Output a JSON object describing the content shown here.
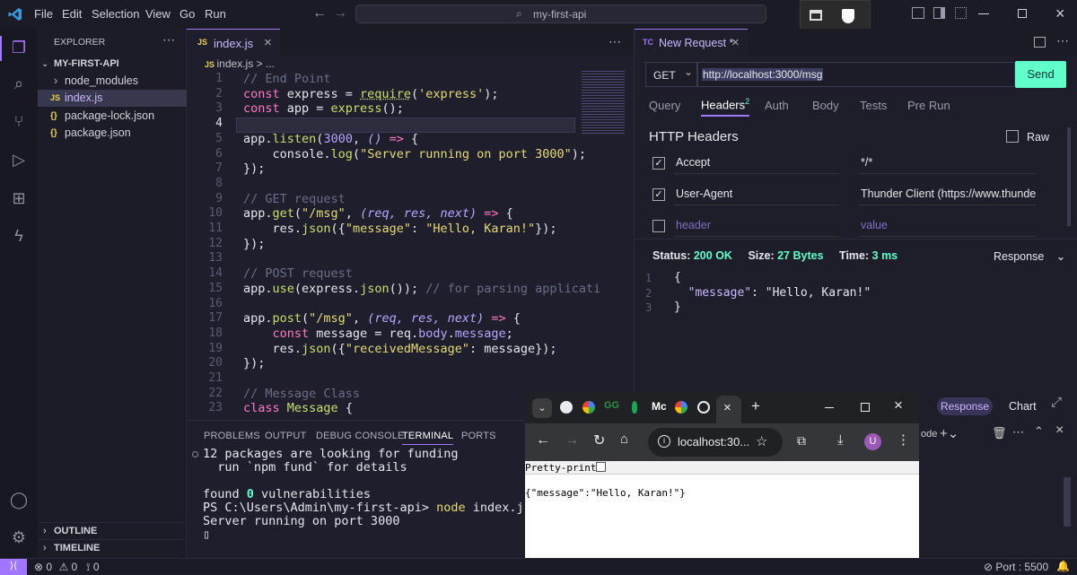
{
  "menu": [
    "File",
    "Edit",
    "Selection",
    "View",
    "Go",
    "Run"
  ],
  "search": {
    "value": "my-first-api"
  },
  "explorer": {
    "title": "EXPLORER",
    "project": "MY-FIRST-API",
    "items": [
      {
        "icon": "›",
        "label": "node_modules",
        "type": "folder"
      },
      {
        "icon": "JS",
        "label": "index.js",
        "type": "js"
      },
      {
        "icon": "{}",
        "label": "package-lock.json",
        "type": "json"
      },
      {
        "icon": "{}",
        "label": "package.json",
        "type": "json"
      }
    ],
    "outline": "OUTLINE",
    "timeline": "TIMELINE"
  },
  "editor": {
    "tab_icon": "JS",
    "tab_label": "index.js",
    "tab_close": "×",
    "breadcrumb": "index.js > ...",
    "line_numbers": [
      "1",
      "2",
      "3",
      "4",
      "5",
      "6",
      "7",
      "8",
      "9",
      "10",
      "11",
      "12",
      "13",
      "14",
      "15",
      "16",
      "17",
      "18",
      "19",
      "20",
      "21",
      "22",
      "23"
    ]
  },
  "panel": {
    "tabs": [
      "PROBLEMS",
      "OUTPUT",
      "DEBUG CONSOLE",
      "TERMINAL",
      "PORTS"
    ],
    "active_tab": "TERMINAL",
    "lines": [
      "12 packages are looking for funding",
      "  run `npm fund` for details",
      "",
      "found 0 vulnerabilities",
      "PS C:\\Users\\Admin\\my-first-api> node index.js",
      "Server running on port 3000"
    ],
    "cursor": "▯"
  },
  "thunder": {
    "tab_icon": "TC",
    "tab_label": "New Request *",
    "method": "GET",
    "url": "http://localhost:3000/msg",
    "send": "Send",
    "tabs": [
      "Query",
      "Headers",
      "Auth",
      "Body",
      "Tests",
      "Pre Run"
    ],
    "headers_badge": "2",
    "section_title": "HTTP Headers",
    "raw": "Raw",
    "headers": [
      {
        "checked": true,
        "key": "Accept",
        "value": "*/*"
      },
      {
        "checked": true,
        "key": "User-Agent",
        "value": "Thunder Client (https://www.thundercl"
      },
      {
        "checked": false,
        "key": "header",
        "value": "value"
      }
    ],
    "status_label": "Status:",
    "status": "200 OK",
    "size_label": "Size:",
    "size": "27 Bytes",
    "time_label": "Time:",
    "time": "3 ms",
    "response_label": "Response",
    "response_lines": [
      "{",
      "  \"message\": \"Hello, Karan!\"",
      "}"
    ],
    "lower_tabs": [
      "Response",
      "Chart"
    ],
    "terminal_fragment": "ode"
  },
  "chrome": {
    "address": "localhost:30...",
    "pretty_print": "Pretty-print",
    "body": "{\"message\":\"Hello, Karan!\"}",
    "profile": "U"
  },
  "statusbar": {
    "errors": "0",
    "warnings": "0",
    "ports": "0",
    "port_label": "Port : 5500"
  },
  "colors": {
    "accent": "#a277ff",
    "send": "#61ffca",
    "ok": "#61ffca"
  }
}
